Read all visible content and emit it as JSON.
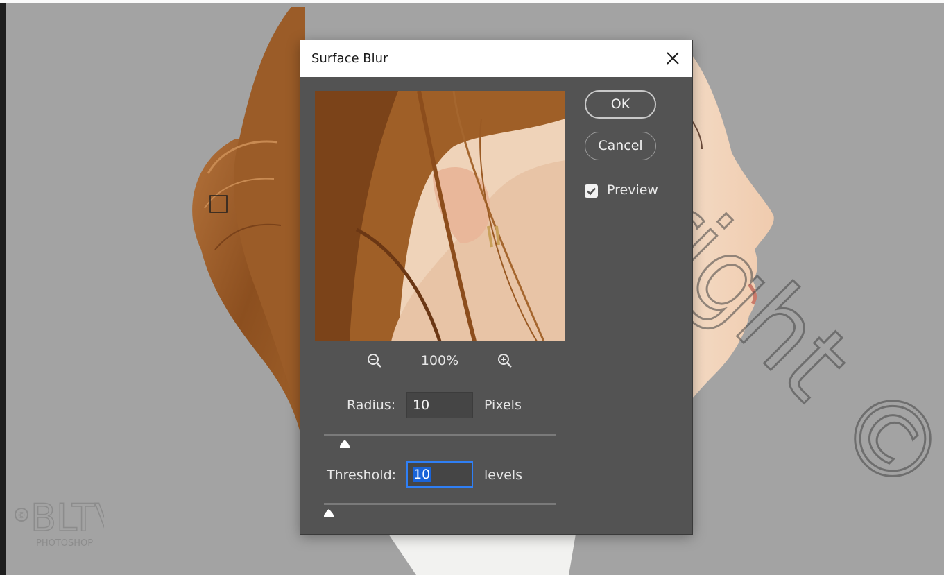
{
  "dialog": {
    "title": "Surface Blur",
    "zoom_level": "100%",
    "ok_label": "OK",
    "cancel_label": "Cancel",
    "preview_label": "Preview",
    "preview_checked": true
  },
  "radius": {
    "label": "Radius:",
    "value": "10",
    "unit": "Pixels",
    "slider_fraction": 0.09
  },
  "threshold": {
    "label": "Threshold:",
    "value": "10",
    "unit": "levels",
    "slider_fraction": 0.02
  },
  "icons": [
    "close-icon",
    "zoom-out-icon",
    "zoom-in-icon",
    "checkmark-icon",
    "slider-thumb-icon"
  ],
  "watermark": {
    "logo_text": "BLTV",
    "sub_text": "PHOTOSHOP"
  },
  "colors": {
    "canvas_bg": "#a3a3a3",
    "dialog_bg": "#535353",
    "field_focus": "#2f7ff5",
    "selection": "#1a64d8",
    "hair": "#9a5a24",
    "skin": "#f1d2b6"
  }
}
